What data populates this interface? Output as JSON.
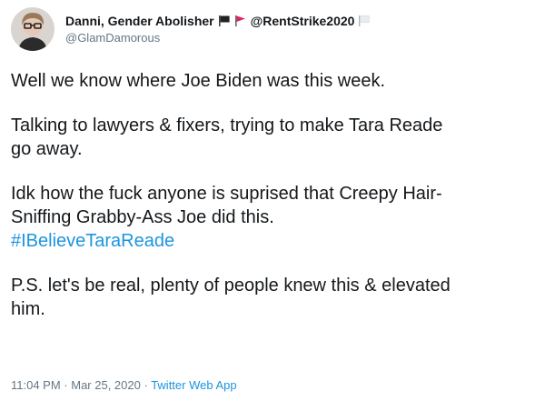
{
  "author": {
    "display_name": "Danni, Gender Abolisher",
    "name_suffix": "@RentStrike2020",
    "handle": "@GlamDamorous",
    "flags": [
      "black-flag-icon",
      "red-flag-icon",
      "white-flag-icon"
    ],
    "colors": {
      "black_flag": "#222222",
      "red_flag": "#e0245e",
      "white_flag": "#e8ecef"
    }
  },
  "tweet": {
    "line1": "Well we know where Joe Biden was this week.",
    "line2a": "Talking to lawyers & fixers, trying to make Tara Reade",
    "line2b": "go away.",
    "line3a": "Idk how the fuck anyone is suprised that Creepy Hair-",
    "line3b": "Sniffing Grabby-Ass Joe did this.",
    "hashtag": "#IBelieveTaraReade",
    "line4a": "P.S. let's be real, plenty of people knew this & elevated",
    "line4b": "him."
  },
  "meta": {
    "time": "11:04 PM",
    "separator": " · ",
    "date": "Mar 25, 2020",
    "app": "Twitter Web App"
  },
  "colors": {
    "link": "#1b95e0",
    "text": "#14171a",
    "secondary": "#657786"
  }
}
